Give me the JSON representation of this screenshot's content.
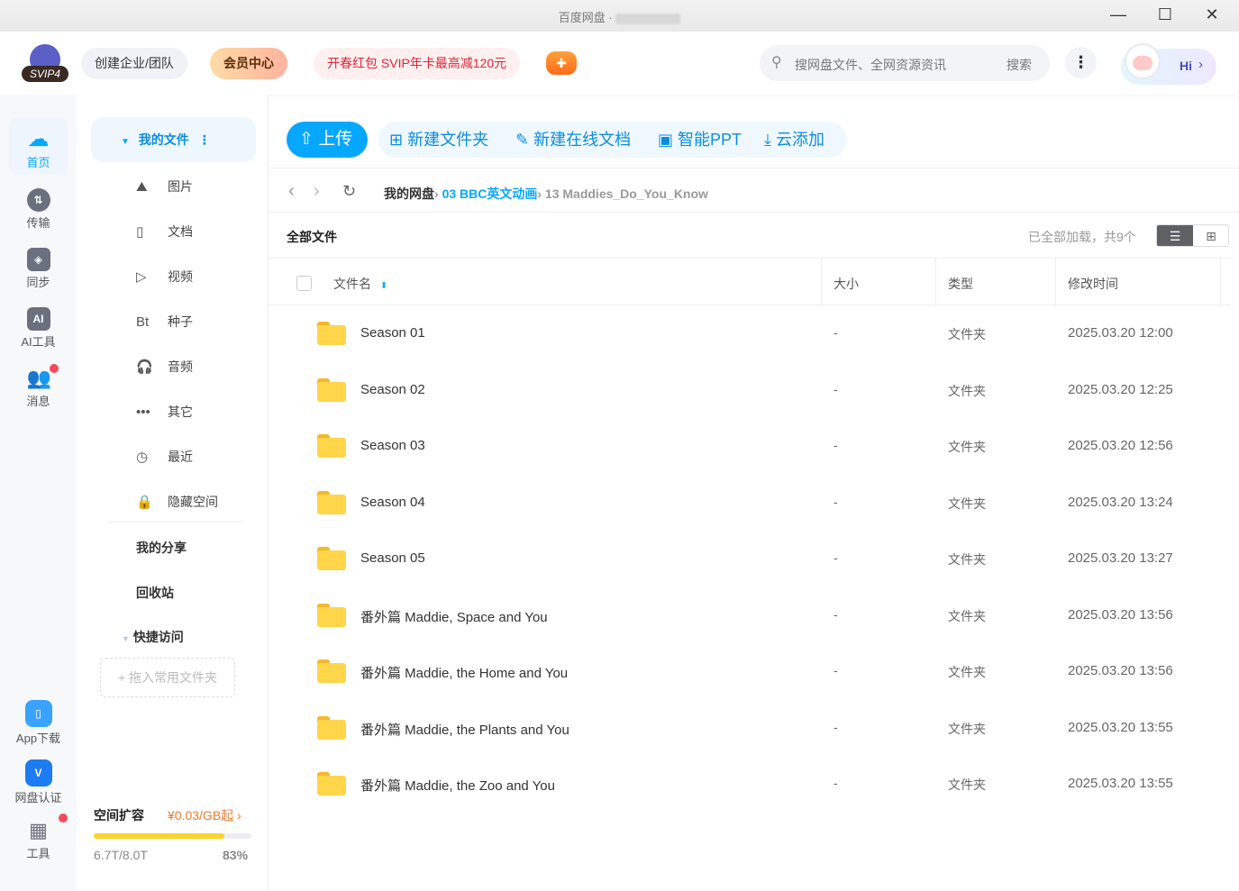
{
  "window": {
    "title": "百度网盘 ·",
    "minimize": "—",
    "maximize": "☐",
    "close": "✕"
  },
  "header": {
    "vip_badge": "SVIP4",
    "create_team": "创建企业/团队",
    "member_center": "会员中心",
    "promo": "开春红包 SVIP年卡最高减120元",
    "search_placeholder": "搜网盘文件、全网资源资讯",
    "search_button": "搜索",
    "assistant": "Hi"
  },
  "rail": [
    {
      "label": "首页",
      "icon": "cloud-logo-icon"
    },
    {
      "label": "传输",
      "icon": "transfer-icon"
    },
    {
      "label": "同步",
      "icon": "sync-icon"
    },
    {
      "label": "AI工具",
      "icon": "ai-icon"
    },
    {
      "label": "消息",
      "icon": "message-icon"
    },
    {
      "label": "App下载",
      "icon": "phone-icon"
    },
    {
      "label": "网盘认证",
      "icon": "verify-icon"
    },
    {
      "label": "工具",
      "icon": "tools-icon"
    }
  ],
  "nav": {
    "my_files": "我的文件",
    "items": [
      {
        "icon": "⛰",
        "label": "图片"
      },
      {
        "icon": "▯",
        "label": "文档"
      },
      {
        "icon": "▷",
        "label": "视频"
      },
      {
        "icon": "Bt",
        "label": "种子"
      },
      {
        "icon": "🎧",
        "label": "音频"
      },
      {
        "icon": "•••",
        "label": "其它"
      },
      {
        "icon": "◷",
        "label": "最近"
      },
      {
        "icon": "🔒",
        "label": "隐藏空间"
      }
    ],
    "my_share": "我的分享",
    "recycle": "回收站",
    "quick_access": "快捷访问",
    "drop_hint": "+ 拖入常用文件夹"
  },
  "storage": {
    "title": "空间扩容",
    "price": "¥0.03/GB起 ›",
    "used": "6.7T/8.0T",
    "percent_label": "83%",
    "percent": 83
  },
  "toolbar": {
    "upload": "上传",
    "new_folder": "新建文件夹",
    "new_doc": "新建在线文档",
    "ppt": "智能PPT",
    "cloud_add": "云添加"
  },
  "breadcrumb": {
    "root": "我的网盘",
    "parent": "03 BBC英文动画",
    "current": "13 Maddies_Do_You_Know",
    "sep": "›"
  },
  "list": {
    "title": "全部文件",
    "status": "已全部加载，共9个",
    "columns": [
      "文件名",
      "大小",
      "类型",
      "修改时间"
    ],
    "rows": [
      {
        "name": "Season 01",
        "size": "-",
        "type": "文件夹",
        "modified": "2025.03.20 12:00"
      },
      {
        "name": "Season 02",
        "size": "-",
        "type": "文件夹",
        "modified": "2025.03.20 12:25"
      },
      {
        "name": "Season 03",
        "size": "-",
        "type": "文件夹",
        "modified": "2025.03.20 12:56"
      },
      {
        "name": "Season 04",
        "size": "-",
        "type": "文件夹",
        "modified": "2025.03.20 13:24"
      },
      {
        "name": "Season 05",
        "size": "-",
        "type": "文件夹",
        "modified": "2025.03.20 13:27"
      },
      {
        "name": "番外篇 Maddie, Space and You",
        "size": "-",
        "type": "文件夹",
        "modified": "2025.03.20 13:56"
      },
      {
        "name": "番外篇 Maddie, the Home and You",
        "size": "-",
        "type": "文件夹",
        "modified": "2025.03.20 13:56"
      },
      {
        "name": "番外篇 Maddie, the Plants and You",
        "size": "-",
        "type": "文件夹",
        "modified": "2025.03.20 13:55"
      },
      {
        "name": "番外篇 Maddie, the Zoo and You",
        "size": "-",
        "type": "文件夹",
        "modified": "2025.03.20 13:55"
      }
    ]
  },
  "colors": {
    "accent": "#06a7ff",
    "promo": "#e02433",
    "vip": "#ffd9a0",
    "progress": "#fcd22d"
  }
}
